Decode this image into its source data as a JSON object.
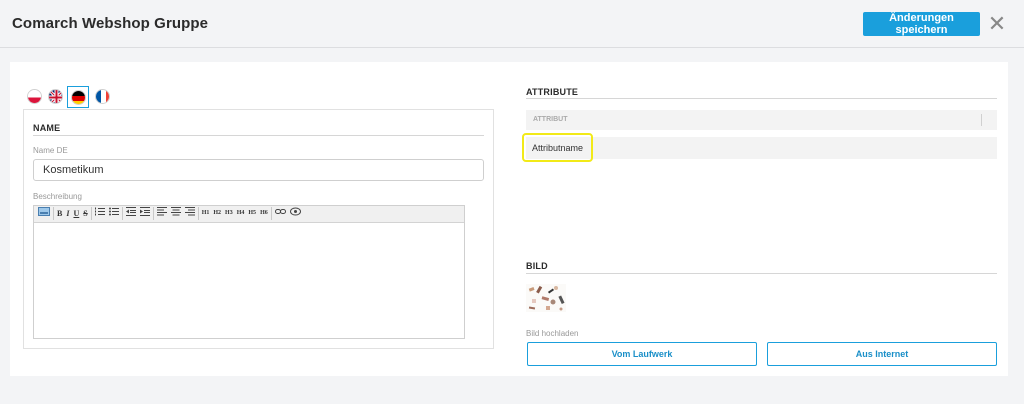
{
  "header": {
    "title": "Comarch Webshop Gruppe",
    "save_label": "Änderungen speichern",
    "close_glyph": "✕",
    "accent": "#1a9fdc"
  },
  "languages": {
    "items": [
      {
        "code": "pl",
        "icon": "flag-poland-icon"
      },
      {
        "code": "en",
        "icon": "flag-uk-icon"
      },
      {
        "code": "de",
        "icon": "flag-germany-icon",
        "active": true
      },
      {
        "code": "fr",
        "icon": "flag-france-icon"
      }
    ]
  },
  "name_section": {
    "heading": "NAME",
    "name_label": "Name DE",
    "name_value": "Kosmetikum",
    "description_label": "Beschreibung"
  },
  "editor_toolbar": {
    "buttons": [
      "B",
      "I",
      "U",
      "S",
      "H1",
      "H2",
      "H3",
      "H4",
      "H5",
      "H6"
    ]
  },
  "attribute_section": {
    "heading": "ATTRIBUTE",
    "column_header": "ATTRIBUT",
    "row_name": "Attributname",
    "highlight_color": "#f2ea18"
  },
  "image_section": {
    "heading": "BILD",
    "upload_label": "Bild hochladen",
    "drive_button": "Vom Laufwerk",
    "internet_button": "Aus Internet"
  }
}
